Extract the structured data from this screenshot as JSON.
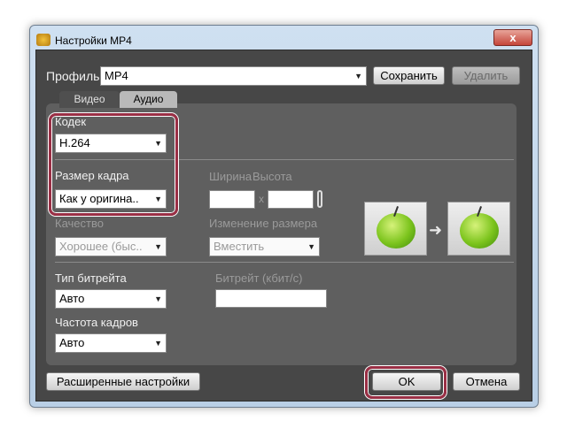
{
  "window": {
    "title": "Настройки MP4",
    "close": "x"
  },
  "profile": {
    "label": "Профиль:",
    "value": "MP4",
    "save": "Сохранить",
    "delete": "Удалить"
  },
  "tabs": [
    {
      "label": "Видео"
    },
    {
      "label": "Аудио"
    }
  ],
  "codec": {
    "label": "Кодек",
    "value": "H.264"
  },
  "frame_size": {
    "label": "Размер кадра",
    "value": "Как у оригина.."
  },
  "width_label": "Ширина",
  "height_label": "Высота",
  "x_sep": "x",
  "quality": {
    "label": "Качество",
    "value": "Хорошее (быс.."
  },
  "resize": {
    "label": "Изменение размера",
    "value": "Вместить"
  },
  "bitrate_type": {
    "label": "Тип битрейта",
    "value": "Авто"
  },
  "bitrate": {
    "label": "Битрейт (кбит/с)",
    "value": ""
  },
  "framerate": {
    "label": "Частота кадров",
    "value": "Авто"
  },
  "buttons": {
    "advanced": "Расширенные настройки",
    "ok": "OK",
    "cancel": "Отмена"
  }
}
